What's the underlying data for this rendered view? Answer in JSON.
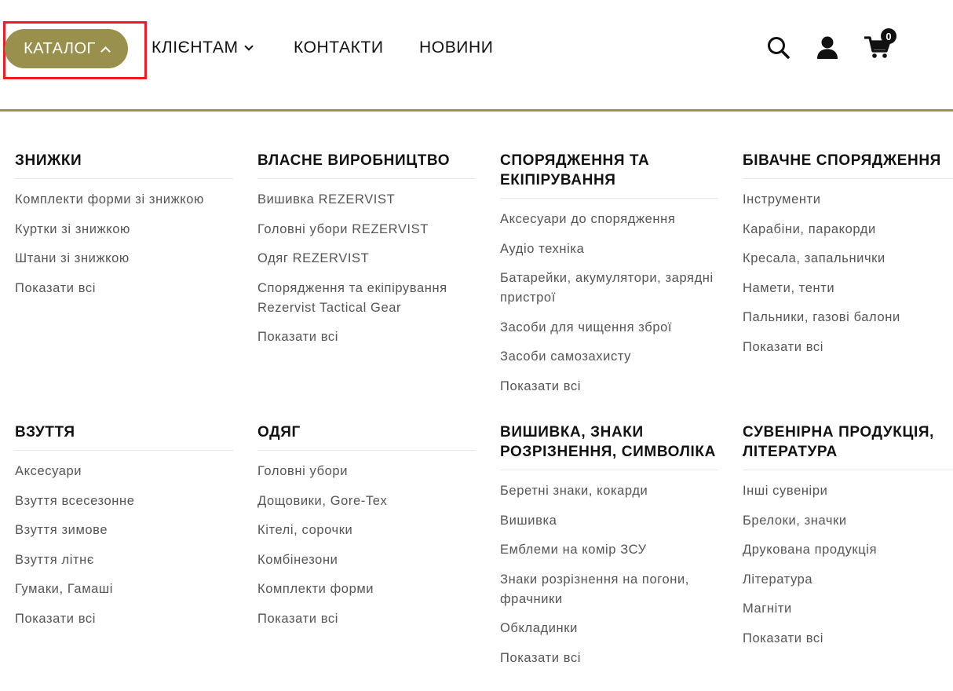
{
  "header": {
    "catalog_label": "КАТАЛОГ",
    "nav": {
      "clients": "КЛІЄНТАМ",
      "contacts": "КОНТАКТИ",
      "news": "НОВИНИ"
    },
    "cart_count": "0",
    "icons": [
      "search-icon",
      "user-icon",
      "cart-icon"
    ],
    "accent_color": "#9a904d",
    "highlight_color": "#ee1c24"
  },
  "menu": {
    "columns": [
      {
        "title": "Знижки",
        "links": [
          "Комплекти форми зі знижкою",
          "Куртки зі знижкою",
          "Штани зі знижкою",
          "Показати всі"
        ]
      },
      {
        "title": "Власне виробництво",
        "links": [
          "Вишивка REZERVIST",
          "Головні убори REZERVIST",
          "Одяг REZERVIST",
          "Спорядження та екіпірування Rezervist Tactical Gear",
          "Показати всі"
        ]
      },
      {
        "title": "Спорядження та екіпірування",
        "links": [
          "Аксесуари до спорядження",
          "Аудіо техніка",
          "Батарейки, акумулятори, зарядні пристрої",
          "Засоби для чищення зброї",
          "Засоби самозахисту",
          "Показати всі"
        ]
      },
      {
        "title": "Бівачне спорядження",
        "links": [
          "Інструменти",
          "Карабіни, паракорди",
          "Кресала, запальнички",
          "Намети, тенти",
          "Пальники, газові балони",
          "Показати всі"
        ]
      },
      {
        "title": "Взуття",
        "links": [
          "Аксесуари",
          "Взуття всесезонне",
          "Взуття зимове",
          "Взуття літнє",
          "Гумаки, Гамаші",
          "Показати всі"
        ]
      },
      {
        "title": "Одяг",
        "links": [
          "Головні убори",
          "Дощовики, Gore-Tex",
          "Кітелі, сорочки",
          "Комбінезони",
          "Комплекти форми",
          "Показати всі"
        ]
      },
      {
        "title": "Вишивка, знаки розрізнення, символіка",
        "links": [
          "Беретні знаки, кокарди",
          "Вишивка",
          "Емблеми на комір ЗСУ",
          "Знаки розрізнення на погони, фрачники",
          "Обкладинки",
          "Показати всі"
        ]
      },
      {
        "title": "Сувенірна продукція, література",
        "links": [
          "Інші сувеніри",
          "Брелоки, значки",
          "Друкована продукція",
          "Література",
          "Магніти",
          "Показати всі"
        ]
      }
    ]
  }
}
